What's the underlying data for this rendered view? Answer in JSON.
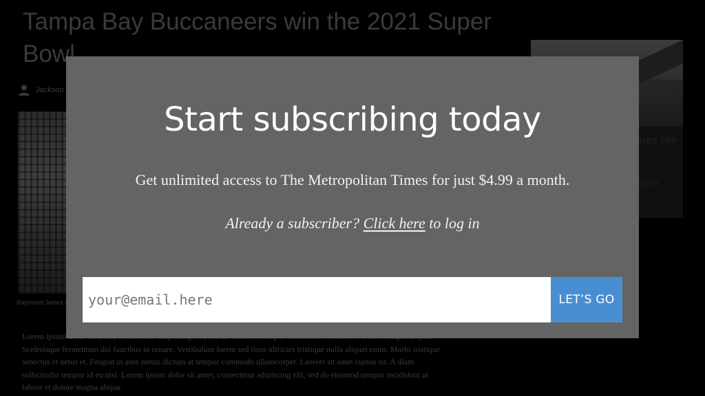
{
  "article": {
    "headline": "Tampa Bay Buccaneers win the 2021 Super Bowl",
    "author": "Jackson",
    "photo_caption": "Raymond James Stadium and Border Protection",
    "body_text": "Lorem ipsum dolor sit amet, consectetur adipiscing elit, sed do eiusmod tempor incididunt ut labore et dolore magna aliqua. Scelerisque fermentum dui faucibus in ornare. Vestibulum lorem sed risus ultricies tristique nulla aliquet enim. Morbi tristique senectus et netus et. Feugiat in ante metus dictum at tempor commodo ullamcorper. Laoreet sit amet cursus sit. A diam sollicitudin tempor id eu nisl. Lorem ipsum dolor sit amet, consectetur adipiscing elit, sed do eiusmod tempor incididunt ut labore et dolore magna aliqua."
  },
  "side_card": {
    "title": "homes ide",
    "meta": "500k"
  },
  "modal": {
    "title": "Start subscribing today",
    "subtitle": "Get unlimited access to The Metropolitan Times for just $4.99 a month.",
    "login_prefix": "Already a subscriber? ",
    "login_link": "Click here",
    "login_suffix": " to log in",
    "email_placeholder": "your@email.here",
    "email_value": "",
    "submit_label": "LET’S GO"
  },
  "colors": {
    "overlay_background": "#000000",
    "modal_background": "#646464",
    "button_accent": "#4a8ed2"
  },
  "icons": {
    "byline": "user-icon"
  }
}
